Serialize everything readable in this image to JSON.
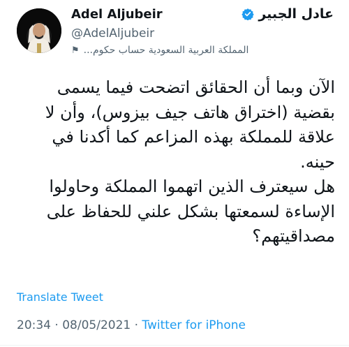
{
  "profile": {
    "name_en": "Adel Aljubeir",
    "name_ar": "عادل الجبير",
    "handle": "@AdelAljubeir",
    "label": "المملكة العربية السعودية حساب حكوم...",
    "label_icon": "flag-icon",
    "verified_icon": "verified-badge-icon"
  },
  "tweet": {
    "lines": [
      "الآن وبما أن الحقائق اتضحت فيما يسمى",
      "بقضية (اختراق هاتف جيف بيزوس)، وأن لا",
      "علاقة للمملكة بهذه المزاعم كما أكدنا في",
      "حينه.",
      "هل سيعترف الذين اتهموا المملكة وحاولوا",
      "الإساءة لسمعتها بشكل علني للحفاظ على",
      "مصداقيتهم؟"
    ]
  },
  "actions": {
    "translate": "Translate Tweet"
  },
  "meta": {
    "time": "20:34",
    "separator": "·",
    "date": "08/05/2021",
    "source": "Twitter for iPhone"
  },
  "colors": {
    "link": "#1d9bf0",
    "muted": "#536471",
    "text": "#0f1419"
  }
}
